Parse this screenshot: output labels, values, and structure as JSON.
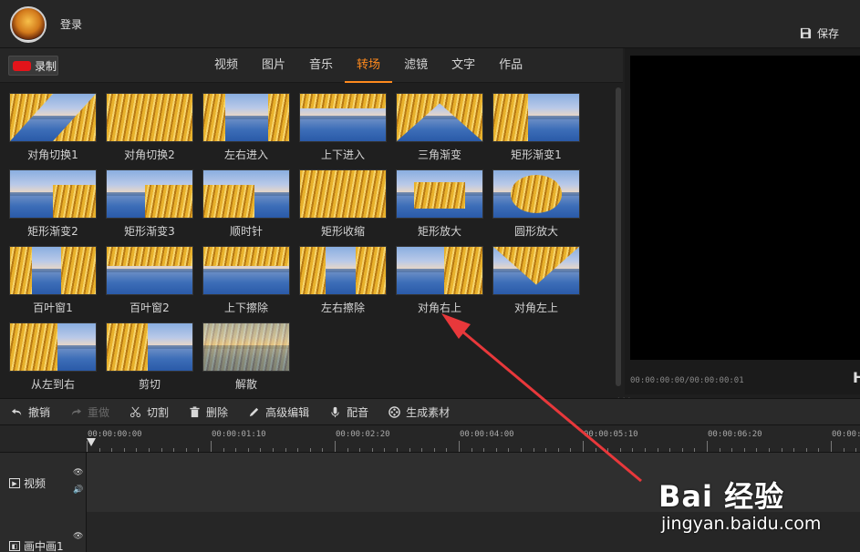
{
  "header": {
    "login_label": "登录",
    "save_label": "保存"
  },
  "record_label": "录制",
  "tabs": [
    {
      "label": "视频"
    },
    {
      "label": "图片"
    },
    {
      "label": "音乐"
    },
    {
      "label": "转场",
      "active": true
    },
    {
      "label": "滤镜"
    },
    {
      "label": "文字"
    },
    {
      "label": "作品"
    }
  ],
  "transitions": [
    "对角切换1",
    "对角切换2",
    "左右进入",
    "上下进入",
    "三角渐变",
    "矩形渐变1",
    "矩形渐变2",
    "矩形渐变3",
    "顺时针",
    "矩形收缩",
    "矩形放大",
    "圆形放大",
    "百叶窗1",
    "百叶窗2",
    "上下擦除",
    "左右擦除",
    "对角右上",
    "对角左上",
    "从左到右",
    "剪切",
    "解散"
  ],
  "preview": {
    "timecode": "00:00:00:00/00:00:00:01",
    "badge": "H"
  },
  "toolbar": [
    {
      "label": "撤销",
      "icon": "undo-icon",
      "enabled": true
    },
    {
      "label": "重做",
      "icon": "redo-icon",
      "enabled": false
    },
    {
      "label": "切割",
      "icon": "scissors-icon",
      "enabled": true
    },
    {
      "label": "删除",
      "icon": "trash-icon",
      "enabled": true
    },
    {
      "label": "高级编辑",
      "icon": "pencil-icon",
      "enabled": true
    },
    {
      "label": "配音",
      "icon": "microphone-icon",
      "enabled": true
    },
    {
      "label": "生成素材",
      "icon": "film-reel-icon",
      "enabled": true
    }
  ],
  "ruler": [
    "00:00:00:00",
    "00:00:01:10",
    "00:00:02:20",
    "00:00:04:00",
    "00:00:05:10",
    "00:00:06:20",
    "00:00:0"
  ],
  "tracks": [
    {
      "name": "视频"
    },
    {
      "name": "画中画1"
    }
  ],
  "watermark": {
    "brand": "Bai 经验",
    "url": "jingyan.baidu.com"
  },
  "colors": {
    "accent": "#ff8a1d",
    "record": "#e3141a",
    "annotation_arrow": "#e8383b"
  }
}
